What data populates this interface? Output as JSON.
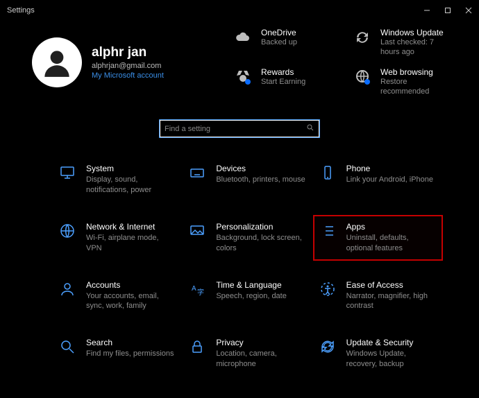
{
  "window": {
    "title": "Settings"
  },
  "profile": {
    "name": "alphr jan",
    "email": "alphrjan@gmail.com",
    "account_link": "My Microsoft account"
  },
  "status": {
    "onedrive": {
      "title": "OneDrive",
      "sub": "Backed up"
    },
    "windows_update": {
      "title": "Windows Update",
      "sub": "Last checked: 7 hours ago"
    },
    "rewards": {
      "title": "Rewards",
      "sub": "Start Earning"
    },
    "web_browsing": {
      "title": "Web browsing",
      "sub": "Restore recommended"
    }
  },
  "search": {
    "placeholder": "Find a setting"
  },
  "categories": {
    "system": {
      "title": "System",
      "sub": "Display, sound, notifications, power"
    },
    "devices": {
      "title": "Devices",
      "sub": "Bluetooth, printers, mouse"
    },
    "phone": {
      "title": "Phone",
      "sub": "Link your Android, iPhone"
    },
    "network": {
      "title": "Network & Internet",
      "sub": "Wi-Fi, airplane mode, VPN"
    },
    "personalization": {
      "title": "Personalization",
      "sub": "Background, lock screen, colors"
    },
    "apps": {
      "title": "Apps",
      "sub": "Uninstall, defaults, optional features"
    },
    "accounts": {
      "title": "Accounts",
      "sub": "Your accounts, email, sync, work, family"
    },
    "time": {
      "title": "Time & Language",
      "sub": "Speech, region, date"
    },
    "ease": {
      "title": "Ease of Access",
      "sub": "Narrator, magnifier, high contrast"
    },
    "search_cat": {
      "title": "Search",
      "sub": "Find my files, permissions"
    },
    "privacy": {
      "title": "Privacy",
      "sub": "Location, camera, microphone"
    },
    "update": {
      "title": "Update & Security",
      "sub": "Windows Update, recovery, backup"
    }
  }
}
